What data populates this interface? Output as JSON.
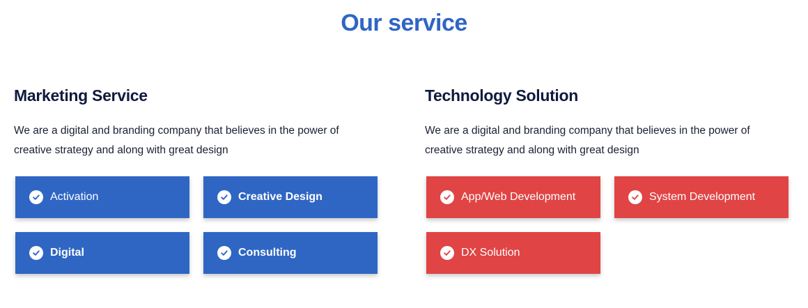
{
  "page": {
    "title": "Our service",
    "title_color": "#2f66c4"
  },
  "icons": {
    "tile_icon": "check-circle-icon"
  },
  "marketing": {
    "heading": "Marketing Service",
    "description": "We are a digital and branding company that believes in the power of creative strategy and along with great design",
    "tile_color": "#2f66c4",
    "items": [
      {
        "label": "Activation"
      },
      {
        "label": "Creative Design"
      },
      {
        "label": "Digital"
      },
      {
        "label": "Consulting"
      }
    ]
  },
  "technology": {
    "heading": "Technology Solution",
    "description": "We are a digital and branding company that believes in the power of creative strategy and along with great design",
    "tile_color": "#e04444",
    "items": [
      {
        "label": "App/Web Development"
      },
      {
        "label": "System Development"
      },
      {
        "label": "DX Solution"
      }
    ]
  }
}
